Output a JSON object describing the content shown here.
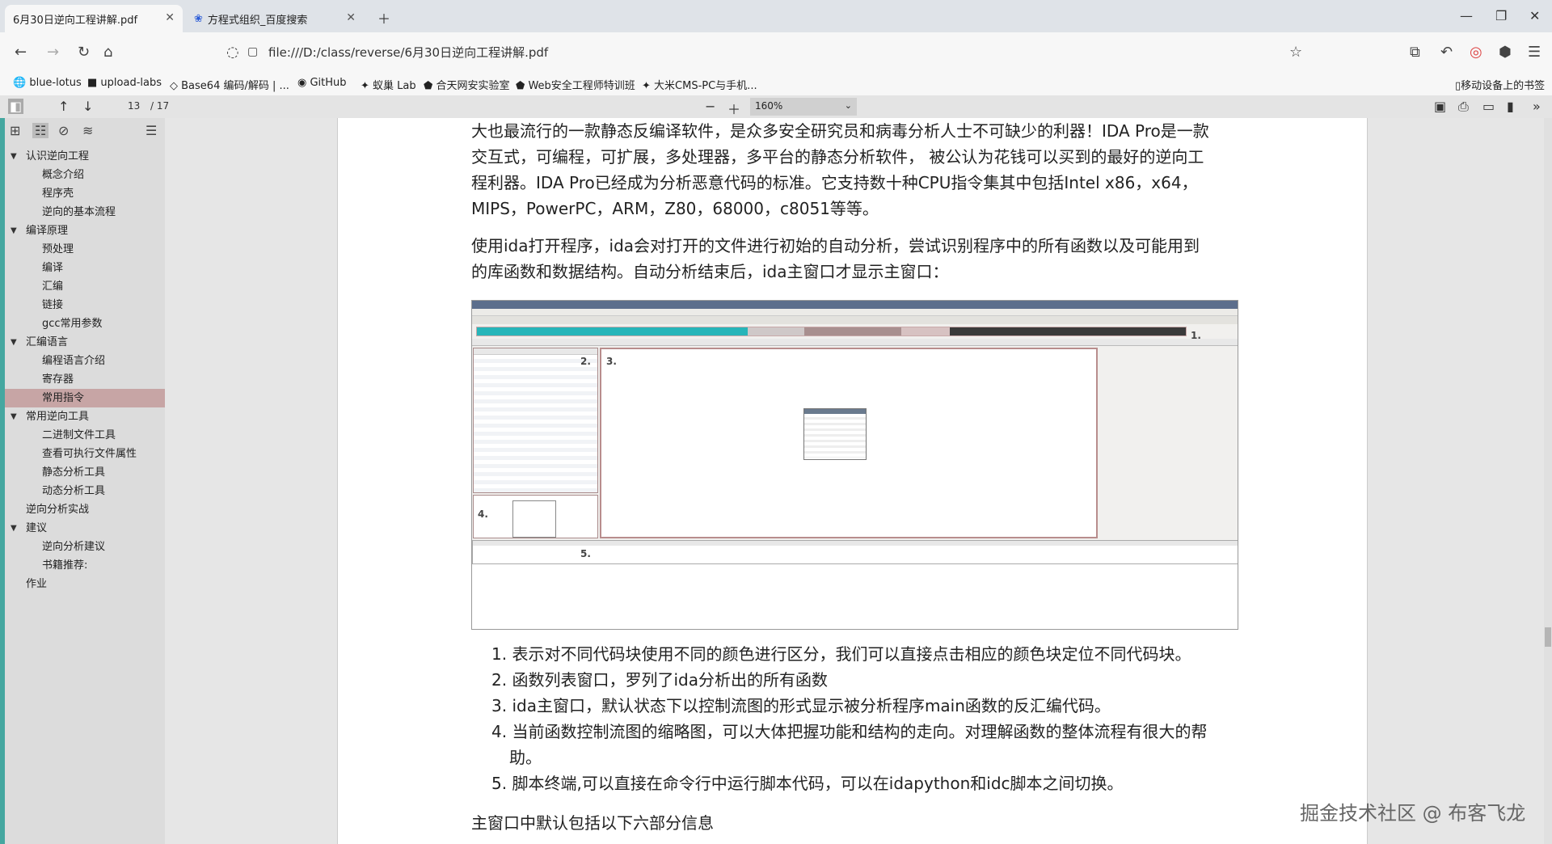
{
  "tabs": [
    {
      "label": "6月30日逆向工程讲解.pdf",
      "active": true
    },
    {
      "label": "方程式组织_百度搜索",
      "active": false
    }
  ],
  "address": {
    "url": "file:///D:/class/reverse/6月30日逆向工程讲解.pdf"
  },
  "bookmarks": [
    {
      "label": "blue-lotus"
    },
    {
      "label": "upload-labs"
    },
    {
      "label": "Base64 编码/解码 | ..."
    },
    {
      "label": "GitHub"
    },
    {
      "label": "蚁巢 Lab"
    },
    {
      "label": "合天网安实验室"
    },
    {
      "label": "Web安全工程师特训班"
    },
    {
      "label": "大米CMS-PC与手机..."
    }
  ],
  "mobile_bookmarks": "移动设备上的书签",
  "pdf_toolbar": {
    "current_page": "13",
    "total_pages": "/ 17",
    "zoom": "160%"
  },
  "outline": [
    {
      "label": "认识逆向工程",
      "level": 0,
      "expanded": true
    },
    {
      "label": "概念介绍",
      "level": 1
    },
    {
      "label": "程序壳",
      "level": 1
    },
    {
      "label": "逆向的基本流程",
      "level": 1
    },
    {
      "label": "编译原理",
      "level": 0,
      "expanded": true
    },
    {
      "label": "预处理",
      "level": 1
    },
    {
      "label": "编译",
      "level": 1
    },
    {
      "label": "汇编",
      "level": 1
    },
    {
      "label": "链接",
      "level": 1
    },
    {
      "label": "gcc常用参数",
      "level": 1
    },
    {
      "label": "汇编语言",
      "level": 0,
      "expanded": true
    },
    {
      "label": "编程语言介绍",
      "level": 1
    },
    {
      "label": "寄存器",
      "level": 1
    },
    {
      "label": "常用指令",
      "level": 1,
      "selected": true
    },
    {
      "label": "常用逆向工具",
      "level": 0,
      "expanded": true
    },
    {
      "label": "二进制文件工具",
      "level": 1
    },
    {
      "label": "查看可执行文件属性",
      "level": 1
    },
    {
      "label": "静态分析工具",
      "level": 1
    },
    {
      "label": "动态分析工具",
      "level": 1
    },
    {
      "label": "逆向分析实战",
      "level": 0
    },
    {
      "label": "建议",
      "level": 0,
      "expanded": true
    },
    {
      "label": "逆向分析建议",
      "level": 1
    },
    {
      "label": "书籍推荐:",
      "level": 1
    },
    {
      "label": "作业",
      "level": 0
    }
  ],
  "document": {
    "para1_lines": [
      "大也最流行的一款静态反编译软件，是众多安全研究员和病毒分析人士不可缺少的利器！IDA Pro是一款",
      "交互式，可编程，可扩展，多处理器，多平台的静态分析软件， 被公认为花钱可以买到的最好的逆向工",
      "程利器。IDA Pro已经成为分析恶意代码的标准。它支持数十种CPU指令集其中包括Intel x86，x64，",
      "MIPS，PowerPC，ARM，Z80，68000，c8051等等。"
    ],
    "para2_lines": [
      "使用ida打开程序，ida会对打开的文件进行初始的自动分析，尝试识别程序中的所有函数以及可能用到",
      "的库函数和数据结构。自动分析结束后，ida主窗口才显示主窗口："
    ],
    "ida_labels": [
      "1.",
      "2.",
      "3.",
      "4.",
      "5."
    ],
    "list_items": [
      "1. 表示对不同代码块使用不同的颜色进行区分，我们可以直接点击相应的颜色块定位不同代码块。",
      "2. 函数列表窗口，罗列了ida分析出的所有函数",
      "3. ida主窗口，默认状态下以控制流图的形式显示被分析程序main函数的反汇编代码。",
      "4. 当前函数控制流图的缩略图，可以大体把握功能和结构的走向。对理解函数的整体流程有很大的帮",
      "助。",
      "5. 脚本终端,可以直接在命令行中运行脚本代码，可以在idapython和idc脚本之间切换。"
    ],
    "para3": "主窗口中默认包括以下六部分信息"
  },
  "watermark": "掘金技术社区 @ 布客飞龙"
}
